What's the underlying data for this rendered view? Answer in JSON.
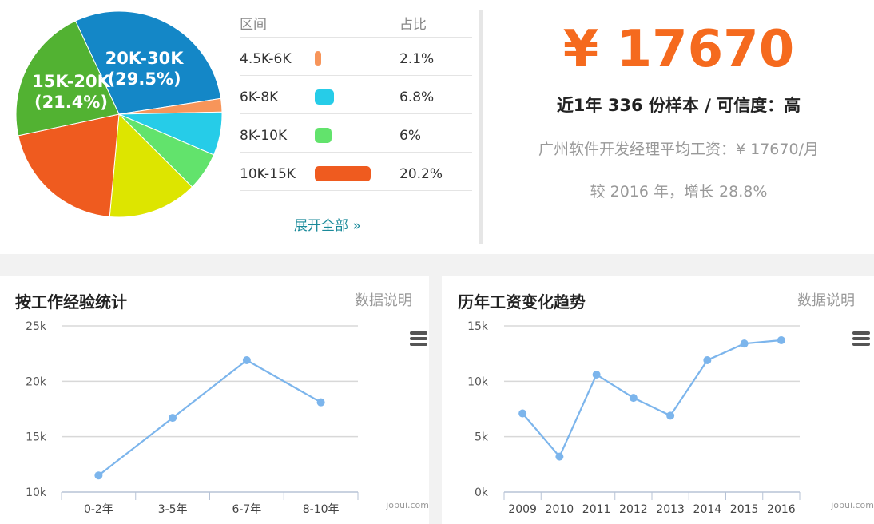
{
  "distribution": {
    "header": {
      "range": "区间",
      "ratio": "占比"
    },
    "rows": [
      {
        "range": "4.5K-6K",
        "ratio": "2.1%",
        "value": 2.1,
        "color": "#f7955a"
      },
      {
        "range": "6K-8K",
        "ratio": "6.8%",
        "value": 6.8,
        "color": "#26cce8"
      },
      {
        "range": "8K-10K",
        "ratio": "6%",
        "value": 6,
        "color": "#62e36c"
      },
      {
        "range": "10K-15K",
        "ratio": "20.2%",
        "value": 20.2,
        "color": "#ef5b1f"
      }
    ],
    "expand_label": "展开全部 »"
  },
  "salary": {
    "amount": "¥ 17670",
    "sample_line": "近1年 336 份样本 / 可信度：高",
    "average_line": "广州软件开发经理平均工资：¥ 17670/月",
    "growth_line": "较 2016 年，增长 28.8%"
  },
  "panels": {
    "experience": {
      "title": "按工作经验统计",
      "note": "数据说明",
      "credit": "jobui.com"
    },
    "trend": {
      "title": "历年工资变化趋势",
      "note": "数据说明",
      "credit": "jobui.com"
    }
  },
  "chart_data": [
    {
      "type": "pie",
      "slices": [
        {
          "label": "20K-30K",
          "value": 29.5,
          "color": "#1487c7",
          "show_label": true
        },
        {
          "label": "4.5K-6K",
          "value": 2.1,
          "color": "#f7955a"
        },
        {
          "label": "6K-8K",
          "value": 6.8,
          "color": "#26cce8"
        },
        {
          "label": "8K-10K",
          "value": 6,
          "color": "#62e36c"
        },
        {
          "label": "",
          "value": 14,
          "color": "#dde500"
        },
        {
          "label": "10K-15K",
          "value": 20.2,
          "color": "#ef5b1f"
        },
        {
          "label": "15K-20K",
          "value": 21.4,
          "color": "#52b232",
          "show_label": true
        }
      ]
    },
    {
      "type": "line",
      "categories": [
        "0-2年",
        "3-5年",
        "6-7年",
        "8-10年"
      ],
      "values": [
        11500,
        16700,
        21900,
        18100
      ],
      "yticks": [
        "10k",
        "15k",
        "20k",
        "25k"
      ],
      "ylim": [
        10000,
        25000
      ],
      "color": "#7cb5ec"
    },
    {
      "type": "line",
      "categories": [
        "2009",
        "2010",
        "2011",
        "2012",
        "2013",
        "2014",
        "2015",
        "2016"
      ],
      "values": [
        7100,
        3200,
        10600,
        8500,
        6900,
        11900,
        13400,
        13700
      ],
      "yticks": [
        "0k",
        "5k",
        "10k",
        "15k"
      ],
      "ylim": [
        0,
        15000
      ],
      "color": "#7cb5ec"
    }
  ]
}
